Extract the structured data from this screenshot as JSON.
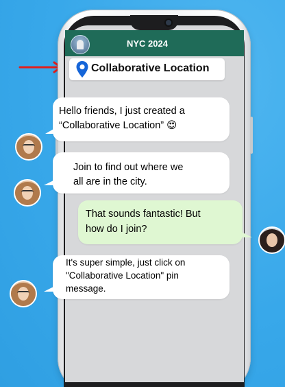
{
  "chat": {
    "group_name": "NYC 2024",
    "pinned_label": "Collaborative Location"
  },
  "icons": {
    "pin": "location-pin-icon",
    "arrow": "red-arrow-icon",
    "emoji": "heart-eyes-emoji"
  },
  "messages": [
    {
      "sender": "friend-1",
      "lines": [
        "Hello friends, I just created a",
        "“Collaborative Location” 😍"
      ]
    },
    {
      "sender": "friend-1",
      "lines": [
        "Join to find out where we",
        "all are in the city."
      ]
    },
    {
      "sender": "me",
      "lines": [
        "That sounds fantastic! But",
        "how do I join?"
      ]
    },
    {
      "sender": "friend-1",
      "lines": [
        "It's super simple, just click on",
        "\"Collaborative Location\" pin",
        "message."
      ]
    }
  ],
  "colors": {
    "background": "#38a8ea",
    "header": "#1f6b58",
    "pin": "#1565d8",
    "outgoing_bubble": "#dff7d2",
    "arrow": "#e0201e"
  }
}
